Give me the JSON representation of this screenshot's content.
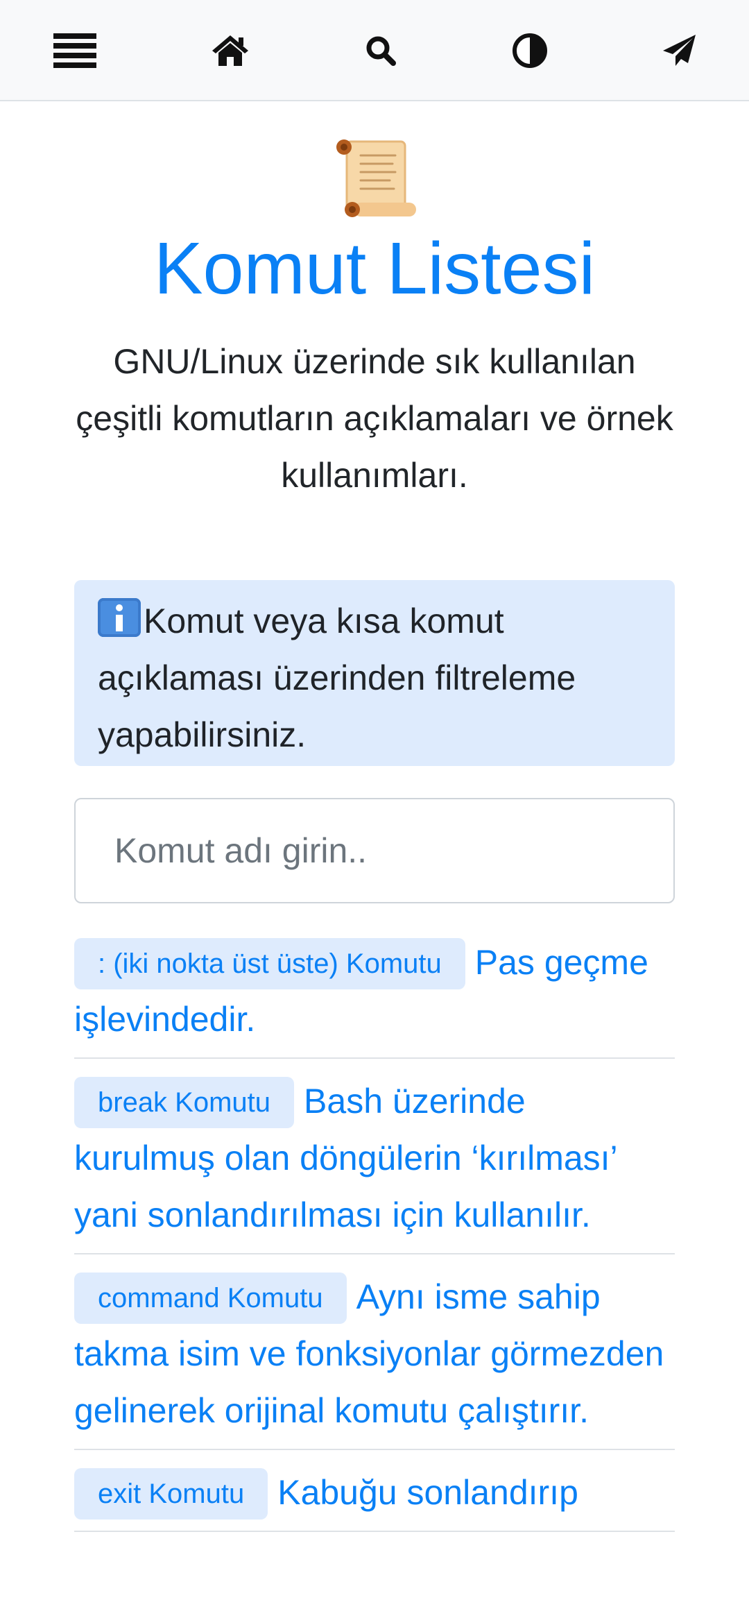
{
  "nav": {
    "menu_icon": "bars-icon",
    "home_icon": "home-icon",
    "search_icon": "search-icon",
    "theme_icon": "adjust-icon",
    "send_icon": "paper-plane-icon"
  },
  "hero": {
    "emoji_icon": "scroll-icon",
    "title": "Komut Listesi",
    "subtitle": "GNU/Linux üzerinde sık kullanılan çeşitli komutların açıklamaları ve örnek kullanımları."
  },
  "info": {
    "icon": "information-icon",
    "text": "Komut veya kısa komut açıklaması üzerinden filtreleme yapabilirsiniz."
  },
  "search": {
    "placeholder": "Komut adı girin..",
    "value": ""
  },
  "commands": [
    {
      "badge": ": (iki nokta üst üste) Komutu",
      "description": "Pas geçme işlevindedir."
    },
    {
      "badge": "break Komutu",
      "description": "Bash üzerinde kurulmuş olan döngülerin ‘kırılması’ yani sonlandırılması için kullanılır."
    },
    {
      "badge": "command Komutu",
      "description": "Aynı isme sahip takma isim ve fonksiyonlar görmezden gelinerek orijinal komutu çalıştırır."
    },
    {
      "badge": "exit Komutu",
      "description": "Kabuğu sonlandırıp"
    }
  ],
  "colors": {
    "accent": "#0a80f5",
    "badge_bg": "#deebfd",
    "nav_bg": "#f8f9fa",
    "text": "#212529"
  }
}
